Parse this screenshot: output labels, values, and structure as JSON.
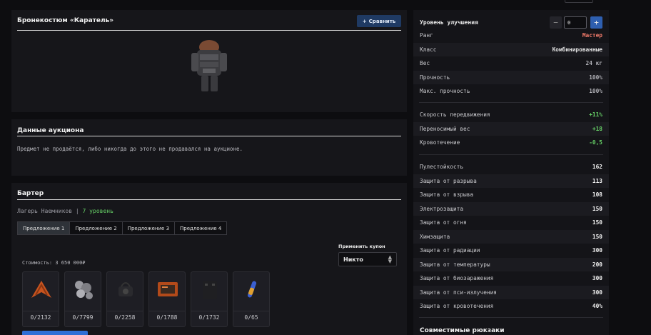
{
  "item": {
    "title": "Бронекостюм «Каратель»",
    "compare_label": "Сравнить"
  },
  "auction": {
    "title": "Данные аукциона",
    "text": "Предмет не продаётся, либо никогда до этого не продавался на аукционе."
  },
  "barter": {
    "title": "Бартер",
    "camp": "Лагерь Наемников",
    "separator": "|",
    "level": "7 уровень",
    "tabs": [
      "Предложение 1",
      "Предложение 2",
      "Предложение 3",
      "Предложение 4"
    ],
    "coupon_label": "Применить купон",
    "coupon_value": "Никто",
    "cost": "Стоимость: 3 650 000₽",
    "items": [
      {
        "icon": "orange-leaf-icon",
        "count": "0/2132"
      },
      {
        "icon": "rock-fragments-icon",
        "count": "0/7799"
      },
      {
        "icon": "dark-gadget-icon",
        "count": "0/2258"
      },
      {
        "icon": "orange-device-icon",
        "count": "0/1788"
      },
      {
        "icon": "black-case-icon",
        "count": "0/1732"
      },
      {
        "icon": "syringe-icon",
        "count": "0/65"
      }
    ]
  },
  "upgrade": {
    "label": "Уровень улучшения",
    "value": "0"
  },
  "base_stats": [
    {
      "label": "Ранг",
      "value": "Мастер",
      "color": "#f07a6a"
    },
    {
      "label": "Класс",
      "value": "Комбинированные",
      "color": "#e0e0e0"
    },
    {
      "label": "Вес",
      "value": "24 кг",
      "color": "#b0b0b6"
    },
    {
      "label": "Прочность",
      "value": "100%",
      "color": "#b0b0b6"
    },
    {
      "label": "Макс. прочность",
      "value": "100%",
      "color": "#b0b0b6"
    }
  ],
  "bonus_stats": [
    {
      "label": "Скорость передвижения",
      "value": "+11%",
      "color": "#67d167"
    },
    {
      "label": "Переносимый вес",
      "value": "+18",
      "color": "#67d167"
    },
    {
      "label": "Кровотечение",
      "value": "-0,5",
      "color": "#67d167"
    }
  ],
  "protection_stats": [
    {
      "label": "Пулестойкость",
      "value": "162"
    },
    {
      "label": "Защита от разрыва",
      "value": "113"
    },
    {
      "label": "Защита от взрыва",
      "value": "108"
    },
    {
      "label": "Электрозащита",
      "value": "150"
    },
    {
      "label": "Защита от огня",
      "value": "150"
    },
    {
      "label": "Химзащита",
      "value": "150"
    },
    {
      "label": "Защита от радиации",
      "value": "300"
    },
    {
      "label": "Защита от температуры",
      "value": "200"
    },
    {
      "label": "Защита от биозаражения",
      "value": "300"
    },
    {
      "label": "Защита от пси-излучения",
      "value": "300"
    },
    {
      "label": "Защита от кровотечения",
      "value": "40%"
    }
  ],
  "backpacks_title": "Совместимые рюкзаки"
}
